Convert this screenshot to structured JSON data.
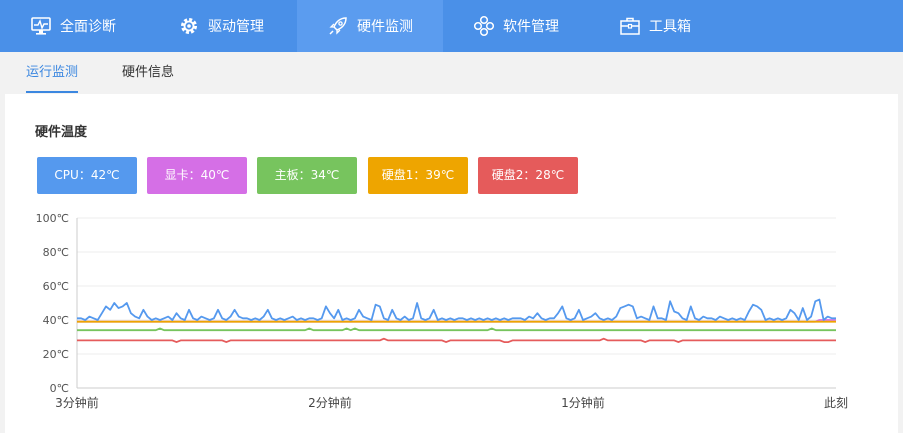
{
  "topnav": {
    "tabs": [
      {
        "label": "全面诊断",
        "icon": "monitor-pulse-icon"
      },
      {
        "label": "驱动管理",
        "icon": "gear-icon"
      },
      {
        "label": "硬件监测",
        "icon": "rocket-icon"
      },
      {
        "label": "软件管理",
        "icon": "apps-icon"
      },
      {
        "label": "工具箱",
        "icon": "toolbox-icon"
      }
    ],
    "active_index": 2,
    "color": "#4a90e8"
  },
  "subnav": {
    "tabs": [
      {
        "label": "运行监测"
      },
      {
        "label": "硬件信息"
      }
    ],
    "active_index": 0
  },
  "section": {
    "title": "硬件温度"
  },
  "badges": [
    {
      "text": "CPU：42℃",
      "color": "#5599ee"
    },
    {
      "text": "显卡：40℃",
      "color": "#d56fe6"
    },
    {
      "text": "主板：34℃",
      "color": "#77c45e"
    },
    {
      "text": "硬盘1：39℃",
      "color": "#eea500"
    },
    {
      "text": "硬盘2：28℃",
      "color": "#e55b5b"
    }
  ],
  "chart_data": {
    "type": "line",
    "title": "",
    "ylim": [
      0,
      100
    ],
    "y_ticks": [
      "0℃",
      "20℃",
      "40℃",
      "60℃",
      "80℃",
      "100℃"
    ],
    "x_ticks": [
      "3分钟前",
      "2分钟前",
      "1分钟前",
      "此刻"
    ],
    "grid": true,
    "series": [
      {
        "name": "CPU",
        "color": "#5599ee",
        "values": [
          41,
          41,
          40,
          42,
          41,
          40,
          44,
          48,
          46,
          50,
          47,
          48,
          50,
          44,
          42,
          41,
          46,
          42,
          40,
          41,
          40,
          41,
          42,
          40,
          44,
          41,
          40,
          46,
          41,
          40,
          42,
          41,
          40,
          41,
          46,
          41,
          40,
          42,
          46,
          42,
          41,
          41,
          40,
          41,
          40,
          42,
          46,
          41,
          40,
          41,
          40,
          41,
          42,
          40,
          41,
          40,
          41,
          41,
          40,
          41,
          48,
          44,
          41,
          46,
          40,
          41,
          40,
          41,
          46,
          42,
          41,
          40,
          49,
          48,
          41,
          40,
          46,
          41,
          40,
          42,
          40,
          41,
          50,
          41,
          40,
          41,
          46,
          40,
          41,
          40,
          41,
          40,
          41,
          41,
          40,
          41,
          40,
          41,
          40,
          41,
          40,
          41,
          40,
          41,
          40,
          41,
          41,
          41,
          40,
          42,
          41,
          44,
          41,
          40,
          41,
          41,
          44,
          48,
          41,
          40,
          41,
          46,
          40,
          41,
          42,
          44,
          41,
          40,
          41,
          40,
          42,
          47,
          48,
          49,
          48,
          41,
          42,
          41,
          40,
          48,
          41,
          41,
          40,
          51,
          45,
          44,
          41,
          40,
          48,
          41,
          40,
          42,
          41,
          41,
          40,
          42,
          41,
          40,
          41,
          40,
          41,
          40,
          45,
          49,
          48,
          46,
          40,
          41,
          40,
          41,
          40,
          41,
          46,
          44,
          40,
          47,
          40,
          42,
          51,
          52,
          40,
          42,
          41,
          41
        ]
      },
      {
        "name": "显卡",
        "color": "#d56fe6",
        "values": [
          39,
          39,
          39,
          39,
          39,
          39,
          39,
          39,
          39,
          39,
          39,
          39,
          39,
          39,
          39,
          39,
          39,
          39,
          39,
          39,
          39,
          39,
          39,
          39,
          39,
          39,
          39,
          39,
          39,
          39,
          39,
          39,
          39,
          39,
          39,
          39,
          39,
          39,
          39,
          39,
          39,
          39,
          39,
          39,
          39,
          39,
          39,
          39,
          39,
          39,
          39,
          39,
          39,
          39,
          39,
          39,
          39,
          39,
          39,
          39,
          39,
          39,
          39,
          39,
          39,
          39,
          39,
          39,
          39,
          39,
          39,
          39,
          39,
          39,
          39,
          39,
          39,
          39,
          39,
          39,
          39,
          39,
          39,
          39,
          39,
          39,
          39,
          39,
          39,
          39,
          39,
          39,
          39,
          39,
          39,
          39,
          39,
          39,
          39,
          39,
          39,
          39,
          39,
          39,
          39,
          39,
          39,
          39,
          39,
          39,
          39,
          39,
          39,
          39,
          39,
          39,
          39,
          39,
          39,
          39,
          39,
          39,
          39,
          39,
          39,
          39,
          39,
          39,
          39,
          39,
          39,
          39,
          39,
          39,
          39,
          39,
          39,
          39,
          39,
          39,
          39,
          39,
          39,
          39,
          39,
          39,
          39,
          39,
          39,
          39,
          39,
          39,
          39,
          39,
          39,
          39,
          39,
          39,
          39,
          39,
          39,
          39,
          39,
          39,
          39,
          39,
          39,
          39,
          39,
          39,
          39,
          39,
          39,
          39,
          39,
          39,
          39,
          39,
          39,
          40,
          40,
          40,
          40,
          40
        ]
      },
      {
        "name": "主板",
        "color": "#77c45e",
        "values": [
          34,
          34,
          34,
          34,
          34,
          34,
          34,
          34,
          34,
          34,
          34,
          34,
          34,
          34,
          34,
          34,
          34,
          34,
          34,
          34,
          35,
          34,
          34,
          34,
          34,
          34,
          34,
          34,
          34,
          34,
          34,
          34,
          34,
          34,
          34,
          34,
          34,
          34,
          34,
          34,
          34,
          34,
          34,
          34,
          34,
          34,
          34,
          34,
          34,
          34,
          34,
          34,
          34,
          34,
          34,
          34,
          35,
          34,
          34,
          34,
          34,
          34,
          34,
          34,
          34,
          35,
          34,
          35,
          34,
          34,
          34,
          34,
          34,
          34,
          34,
          34,
          34,
          34,
          34,
          34,
          34,
          34,
          34,
          34,
          34,
          34,
          34,
          34,
          34,
          34,
          34,
          34,
          34,
          34,
          34,
          34,
          34,
          34,
          34,
          34,
          35,
          34,
          34,
          34,
          34,
          34,
          34,
          34,
          34,
          34,
          34,
          34,
          34,
          34,
          34,
          34,
          34,
          34,
          34,
          34,
          34,
          34,
          34,
          34,
          34,
          34,
          34,
          34,
          34,
          34,
          34,
          34,
          34,
          34,
          34,
          34,
          34,
          34,
          34,
          34,
          34,
          34,
          34,
          34,
          34,
          34,
          34,
          34,
          34,
          34,
          34,
          34,
          34,
          34,
          34,
          34,
          34,
          34,
          34,
          34,
          34,
          34,
          34,
          34,
          34,
          34,
          34,
          34,
          34,
          34,
          34,
          34,
          34,
          34,
          34,
          34,
          34,
          34,
          34,
          34,
          34,
          34,
          34,
          34
        ]
      },
      {
        "name": "硬盘1",
        "color": "#eea500",
        "values": [
          39,
          39,
          39,
          39,
          39,
          39,
          39,
          39,
          39,
          39,
          39,
          39,
          39,
          39,
          39,
          39,
          39,
          39,
          39,
          39,
          39,
          39,
          39,
          39,
          39,
          39,
          39,
          39,
          39,
          39,
          39,
          39,
          39,
          39,
          39,
          39,
          39,
          39,
          39,
          39,
          39,
          39,
          39,
          39,
          39,
          39,
          39,
          39,
          39,
          39,
          39,
          39,
          39,
          39,
          39,
          39,
          39,
          39,
          39,
          39,
          39,
          39,
          39,
          39,
          39,
          39,
          39,
          39,
          39,
          39,
          39,
          39,
          39,
          39,
          39,
          39,
          39,
          39,
          39,
          39,
          39,
          39,
          39,
          39,
          39,
          39,
          39,
          39,
          39,
          39,
          39,
          39,
          39,
          39,
          39,
          39,
          39,
          39,
          39,
          39,
          39,
          39,
          39,
          39,
          39,
          39,
          39,
          39,
          39,
          39,
          39,
          39,
          39,
          39,
          39,
          39,
          39,
          39,
          39,
          39,
          39,
          39,
          39,
          39,
          39,
          39,
          39,
          39,
          39,
          39,
          39,
          39,
          39,
          39,
          39,
          39,
          39,
          39,
          39,
          39,
          39,
          39,
          39,
          39,
          39,
          39,
          39,
          39,
          39,
          39,
          39,
          39,
          39,
          39,
          39,
          39,
          39,
          39,
          39,
          39,
          39,
          39,
          39,
          39,
          39,
          39,
          39,
          39,
          39,
          39,
          39,
          39,
          39,
          39,
          39,
          39,
          39,
          39,
          39,
          39,
          39,
          39,
          39,
          39
        ]
      },
      {
        "name": "硬盘2",
        "color": "#e55b5b",
        "values": [
          28,
          28,
          28,
          28,
          28,
          28,
          28,
          28,
          28,
          28,
          28,
          28,
          28,
          28,
          28,
          28,
          28,
          28,
          28,
          28,
          28,
          28,
          28,
          28,
          27,
          28,
          28,
          28,
          28,
          28,
          28,
          28,
          28,
          28,
          28,
          28,
          27,
          28,
          28,
          28,
          28,
          28,
          28,
          28,
          28,
          28,
          28,
          28,
          28,
          28,
          28,
          28,
          28,
          28,
          28,
          28,
          28,
          28,
          28,
          28,
          28,
          28,
          28,
          28,
          28,
          28,
          28,
          28,
          28,
          28,
          28,
          28,
          28,
          28,
          29,
          28,
          28,
          28,
          28,
          28,
          28,
          28,
          28,
          28,
          28,
          28,
          28,
          28,
          28,
          27,
          28,
          28,
          28,
          28,
          28,
          28,
          28,
          28,
          28,
          28,
          28,
          28,
          28,
          27,
          27,
          28,
          28,
          28,
          28,
          28,
          28,
          28,
          28,
          28,
          28,
          28,
          28,
          28,
          28,
          28,
          28,
          28,
          28,
          28,
          28,
          28,
          28,
          29,
          28,
          28,
          28,
          28,
          28,
          28,
          28,
          28,
          28,
          27,
          28,
          28,
          28,
          28,
          28,
          28,
          28,
          27,
          28,
          28,
          28,
          28,
          28,
          28,
          28,
          28,
          28,
          28,
          28,
          28,
          28,
          28,
          28,
          28,
          28,
          28,
          28,
          28,
          28,
          28,
          28,
          28,
          28,
          28,
          28,
          28,
          28,
          28,
          28,
          28,
          28,
          28,
          28,
          28,
          28,
          28
        ]
      }
    ]
  }
}
